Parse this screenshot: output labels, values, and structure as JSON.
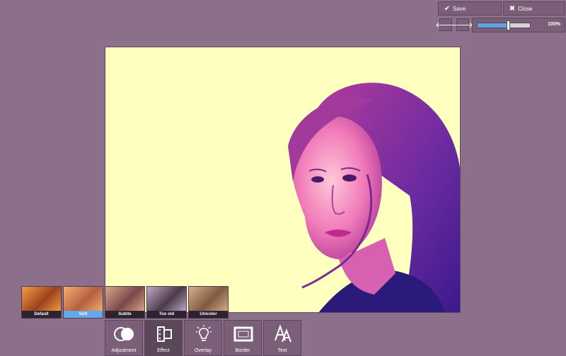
{
  "toolbar": {
    "save_label": "Save",
    "close_label": "Close",
    "undo_icon": "arrow-left-icon",
    "redo_icon": "arrow-right-icon",
    "zoom_value": "100%",
    "zoom_fraction": 0.58
  },
  "effects": [
    {
      "label": "Default",
      "selected": false,
      "colors": [
        "#f0a040",
        "#a04020"
      ]
    },
    {
      "label": "Soft",
      "selected": true,
      "colors": [
        "#f4b070",
        "#b46040"
      ]
    },
    {
      "label": "Subtle",
      "selected": false,
      "colors": [
        "#d9a58a",
        "#7a4a4a"
      ]
    },
    {
      "label": "Too old",
      "selected": false,
      "colors": [
        "#c0a8c8",
        "#4a3a4a"
      ]
    },
    {
      "label": "Unicolor",
      "selected": false,
      "colors": [
        "#d8b090",
        "#805a40"
      ]
    }
  ],
  "tools": [
    {
      "label": "Adjustment",
      "icon": "adjustment-icon"
    },
    {
      "label": "Effect",
      "icon": "film-icon"
    },
    {
      "label": "Overlay",
      "icon": "lightbulb-icon"
    },
    {
      "label": "Border",
      "icon": "frame-icon"
    },
    {
      "label": "Text",
      "icon": "text-icon"
    }
  ],
  "colors": {
    "background": "#8c6f8a",
    "canvas": "#ffffc0",
    "accent": "#63a9ee"
  }
}
